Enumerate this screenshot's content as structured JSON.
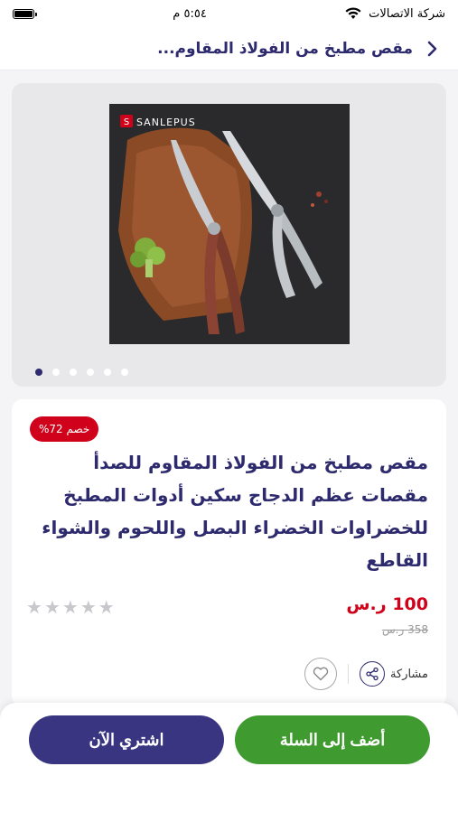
{
  "status_bar": {
    "carrier": "شركة الاتصالات",
    "time": "٥:٥٤ م"
  },
  "header": {
    "title": "مقص مطبخ من الفولاذ المقاوم...",
    "back_icon": "chevron-right-icon"
  },
  "gallery": {
    "brand_watermark": "SANLEPUS",
    "dots_count": 6,
    "active_dot": 0
  },
  "product": {
    "discount_badge": "خصم 72%",
    "title": "مقص مطبخ من الفولاذ المقاوم للصدأ مقصات عظم الدجاج سكين أدوات المطبخ للخضراوات الخضراء البصل واللحوم والشواء القاطع",
    "price": "100 ر.س",
    "old_price": "358 ر.س",
    "rating_stars": 5,
    "share_label": "مشاركة"
  },
  "buttons": {
    "add_to_cart": "أضف إلى السلة",
    "buy_now": "اشتري الآن"
  },
  "colors": {
    "brand": "#2e2a6e",
    "price": "#d0021b",
    "cart_button": "#3f9a2f",
    "buy_button": "#3a3580"
  }
}
